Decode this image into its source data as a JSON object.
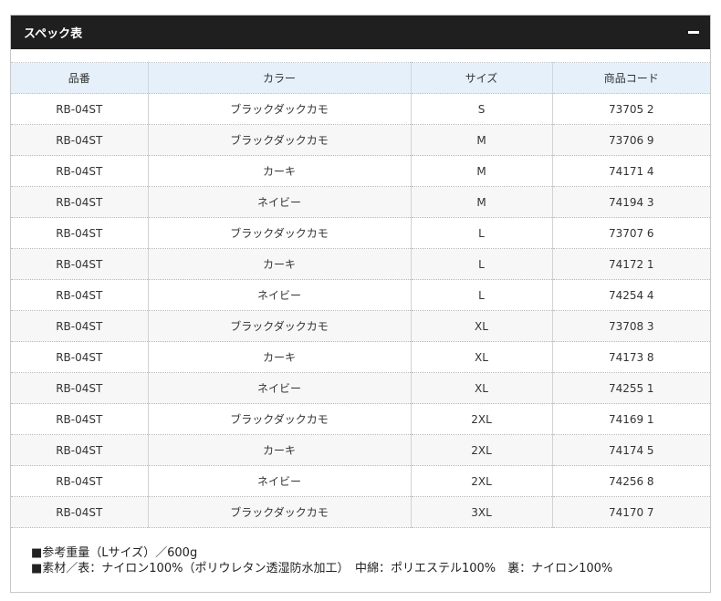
{
  "panel": {
    "title": "スペック表",
    "collapse_symbol": "−"
  },
  "table": {
    "headers": [
      "品番",
      "カラー",
      "サイズ",
      "商品コード"
    ],
    "rows": [
      [
        "RB-04ST",
        "ブラックダックカモ",
        "S",
        "73705 2"
      ],
      [
        "RB-04ST",
        "ブラックダックカモ",
        "M",
        "73706 9"
      ],
      [
        "RB-04ST",
        "カーキ",
        "M",
        "74171 4"
      ],
      [
        "RB-04ST",
        "ネイビー",
        "M",
        "74194 3"
      ],
      [
        "RB-04ST",
        "ブラックダックカモ",
        "L",
        "73707 6"
      ],
      [
        "RB-04ST",
        "カーキ",
        "L",
        "74172 1"
      ],
      [
        "RB-04ST",
        "ネイビー",
        "L",
        "74254 4"
      ],
      [
        "RB-04ST",
        "ブラックダックカモ",
        "XL",
        "73708 3"
      ],
      [
        "RB-04ST",
        "カーキ",
        "XL",
        "74173 8"
      ],
      [
        "RB-04ST",
        "ネイビー",
        "XL",
        "74255 1"
      ],
      [
        "RB-04ST",
        "ブラックダックカモ",
        "2XL",
        "74169 1"
      ],
      [
        "RB-04ST",
        "カーキ",
        "2XL",
        "74174 5"
      ],
      [
        "RB-04ST",
        "ネイビー",
        "2XL",
        "74256 8"
      ],
      [
        "RB-04ST",
        "ブラックダックカモ",
        "3XL",
        "74170 7"
      ]
    ]
  },
  "notes": [
    "■参考重量（Lサイズ）／600g",
    "■素材／表：ナイロン100%（ポリウレタン透湿防水加工）　中綿：ポリエステル100%　裏：ナイロン100%"
  ],
  "colors": {
    "header_bg": "#1f1f1f",
    "table_header_bg": "#e5f0fa",
    "alt_row_bg": "#f7f7f7"
  }
}
